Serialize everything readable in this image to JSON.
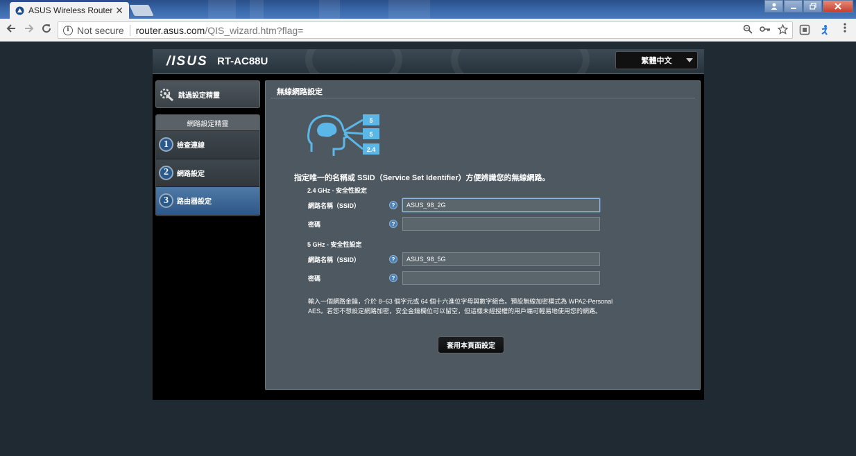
{
  "browser": {
    "tab_title": "ASUS Wireless Router R",
    "tab_close": "✕",
    "security_label": "Not secure",
    "url_host": "router.asus.com",
    "url_path": "/QIS_wizard.htm?flag="
  },
  "router": {
    "logo": "/ISUS",
    "model": "RT-AC88U",
    "language": "繁體中文"
  },
  "sidebar": {
    "skip_label": "跳過設定精靈",
    "wizard_header": "網路設定精靈",
    "steps": [
      {
        "number": "1",
        "label": "檢查連線"
      },
      {
        "number": "2",
        "label": "網路設定"
      },
      {
        "number": "3",
        "label": "路由器設定"
      }
    ]
  },
  "main": {
    "title": "無線網路設定",
    "icon_bands": [
      "5",
      "5",
      "2.4"
    ],
    "description": "指定唯一的名稱或 SSID（Service Set Identifier）方便辨識您的無線網路。",
    "band24": {
      "section": "2.4 GHz - 安全性設定",
      "ssid_label": "網路名稱（SSID）",
      "ssid_value": "ASUS_98_2G",
      "password_label": "密碼",
      "password_value": ""
    },
    "band5": {
      "section": "5 GHz - 安全性設定",
      "ssid_label": "網路名稱（SSID）",
      "ssid_value": "ASUS_98_5G",
      "password_label": "密碼",
      "password_value": ""
    },
    "help_glyph": "?",
    "note_line1": "輸入一個網路金鑰，介於 8~63 個字元或 64 個十六進位字母與數字組合。預設無線加密模式為 WPA2-Personal",
    "note_line2": "AES。若您不想設定網路加密，安全金鑰欄位可以留空，但這樣未經授權的用戶端可輕易地使用您的網路。",
    "apply_label": "套用本頁面設定"
  }
}
